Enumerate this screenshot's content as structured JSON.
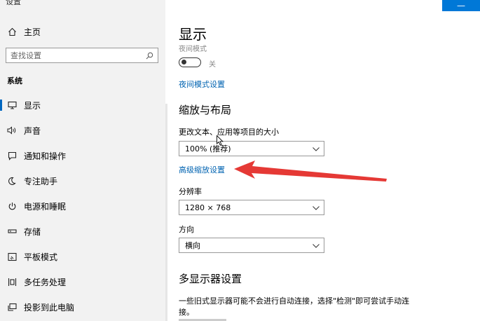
{
  "window": {
    "title": "设置"
  },
  "corner_button": {
    "label": "—"
  },
  "sidebar": {
    "home_label": "主页",
    "search_placeholder": "查找设置",
    "section_label": "系统",
    "items": [
      {
        "label": "显示",
        "icon": "monitor-icon",
        "active": true
      },
      {
        "label": "声音",
        "icon": "speaker-icon"
      },
      {
        "label": "通知和操作",
        "icon": "notification-icon"
      },
      {
        "label": "专注助手",
        "icon": "moon-icon"
      },
      {
        "label": "电源和睡眠",
        "icon": "power-icon"
      },
      {
        "label": "存储",
        "icon": "storage-icon"
      },
      {
        "label": "平板模式",
        "icon": "tablet-icon"
      },
      {
        "label": "多任务处理",
        "icon": "multitask-icon"
      },
      {
        "label": "投影到此电脑",
        "icon": "project-icon"
      }
    ]
  },
  "main": {
    "title": "显示",
    "night_mode": {
      "label": "夜间模式",
      "state_label": "关",
      "on": false
    },
    "night_mode_link": "夜间模式设置",
    "scale_section": {
      "heading": "缩放与布局",
      "change_size_label": "更改文本、应用等项目的大小",
      "scale_value": "100% (推荐)",
      "advanced_link": "高级缩放设置",
      "resolution_label": "分辨率",
      "resolution_value": "1280 × 768",
      "orientation_label": "方向",
      "orientation_value": "横向"
    },
    "multi_display": {
      "heading": "多显示器设置",
      "description_line1": "一些旧式显示器可能不会进行自动连接，选择\"检测\"即可尝试手动连",
      "description_line2": "接。"
    }
  },
  "annotation": {
    "arrow_color": "#e53935"
  },
  "colors": {
    "accent": "#0078d7",
    "link": "#0063b1",
    "sidebar_bg": "#f2f2f2"
  }
}
